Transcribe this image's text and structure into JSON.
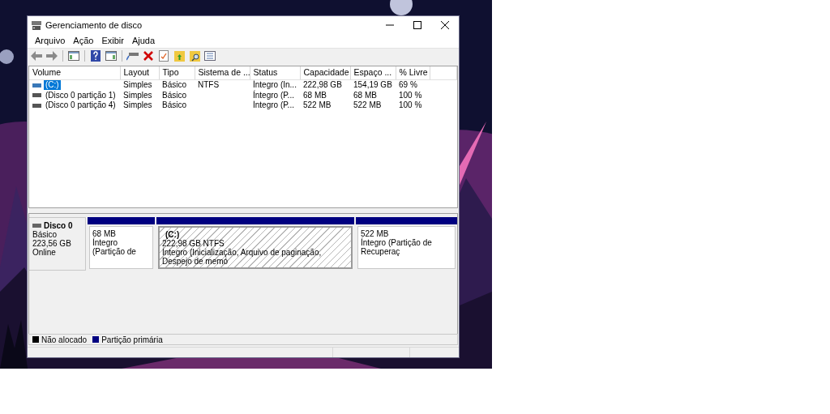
{
  "window": {
    "title": "Gerenciamento de disco"
  },
  "menu": [
    "Arquivo",
    "Ação",
    "Exibir",
    "Ajuda"
  ],
  "volumes": {
    "columns": [
      "Volume",
      "Layout",
      "Tipo",
      "Sistema de ...",
      "Status",
      "Capacidade",
      "Espaço ...",
      "% Livre"
    ],
    "rows": [
      {
        "selected": true,
        "cells": [
          "(C:)",
          "Simples",
          "Básico",
          "NTFS",
          "Íntegro (In...",
          "222,98 GB",
          "154,19 GB",
          "69 %"
        ]
      },
      {
        "selected": false,
        "cells": [
          "(Disco 0 partição 1)",
          "Simples",
          "Básico",
          "",
          "Íntegro (P...",
          "68 MB",
          "68 MB",
          "100 %"
        ]
      },
      {
        "selected": false,
        "cells": [
          "(Disco 0 partição 4)",
          "Simples",
          "Básico",
          "",
          "Íntegro (P...",
          "522 MB",
          "522 MB",
          "100 %"
        ]
      }
    ]
  },
  "disk": {
    "name": "Disco 0",
    "type": "Básico",
    "size": "223,56 GB",
    "status": "Online",
    "partitions": [
      {
        "size": "68 MB",
        "status": "Íntegro (Partição de",
        "selected": false
      },
      {
        "title": "(C:)",
        "size": "222,98 GB NTFS",
        "status": "Íntegro (Inicialização, Arquivo de paginação, Despejo de memó",
        "selected": true
      },
      {
        "size": "522 MB",
        "status": "Íntegro (Partição de Recuperaç",
        "selected": false
      }
    ]
  },
  "legend": [
    {
      "label": "Não alocado",
      "color": "#000000"
    },
    {
      "label": "Partição primária",
      "color": "#000080"
    }
  ]
}
